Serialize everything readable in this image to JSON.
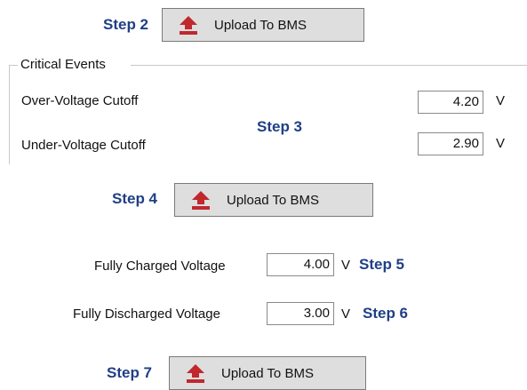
{
  "steps": {
    "step2": "Step 2",
    "step3": "Step 3",
    "step4": "Step 4",
    "step5": "Step 5",
    "step6": "Step 6",
    "step7": "Step 7"
  },
  "buttons": {
    "upload_label": "Upload To BMS",
    "icon": "upload-icon",
    "icon_color": "#c0282e"
  },
  "critical_events": {
    "title": "Critical Events",
    "over_voltage": {
      "label": "Over-Voltage Cutoff",
      "value": "4.20",
      "unit": "V"
    },
    "under_voltage": {
      "label": "Under-Voltage Cutoff",
      "value": "2.90",
      "unit": "V"
    }
  },
  "voltages": {
    "fully_charged": {
      "label": "Fully Charged Voltage",
      "value": "4.00",
      "unit": "V"
    },
    "fully_discharged": {
      "label": "Fully Discharged Voltage",
      "value": "3.00",
      "unit": "V"
    }
  },
  "colors": {
    "step_text": "#1f3f86",
    "button_bg": "#dedede",
    "group_border": "#c9c9c9"
  }
}
